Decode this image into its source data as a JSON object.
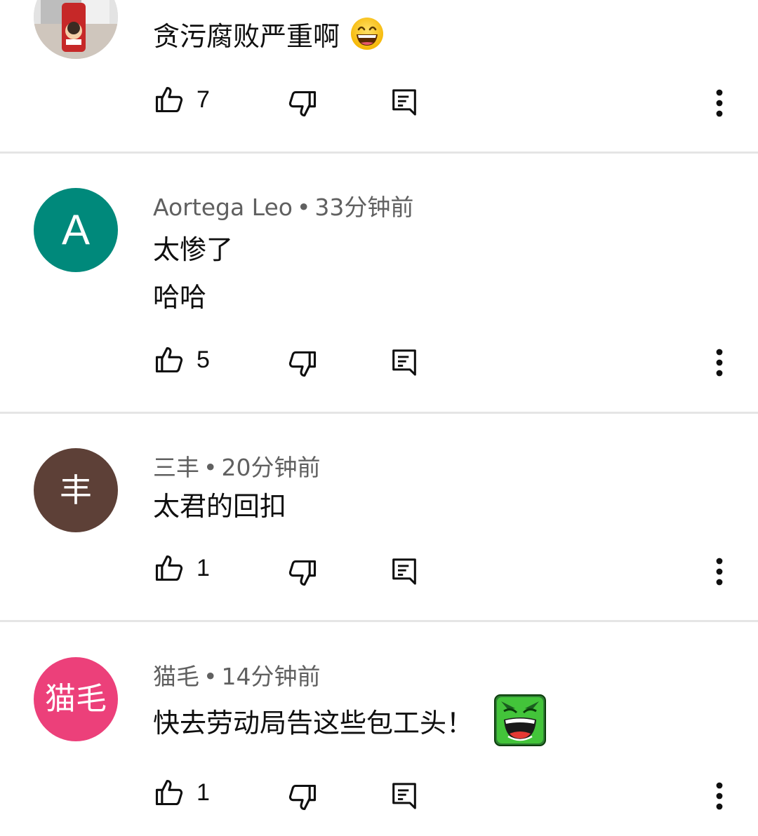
{
  "comments": [
    {
      "author": "",
      "time": "",
      "lines": [
        "贪污腐败严重啊"
      ],
      "emoji": "grinning-face-emoji",
      "likes": "7",
      "avatar_type": "photo",
      "avatar_text": ""
    },
    {
      "author": "Aortega Leo",
      "time": "33分钟前",
      "lines": [
        "太惨了",
        "哈哈"
      ],
      "likes": "5",
      "avatar_type": "letter",
      "avatar_text": "A",
      "avatar_color": "#00897b"
    },
    {
      "author": "三丰",
      "time": "20分钟前",
      "lines": [
        "太君的回扣"
      ],
      "likes": "1",
      "avatar_type": "letter",
      "avatar_text": "丰",
      "avatar_color": "#5d4037"
    },
    {
      "author": "猫毛",
      "time": "14分钟前",
      "lines": [
        "快去劳动局告这些包工头！"
      ],
      "emoji": "hulk-laughing-sticker",
      "likes": "1",
      "avatar_type": "letter",
      "avatar_text": "猫毛",
      "avatar_color": "#ec407a"
    }
  ],
  "meta_separator": "•",
  "icons": {
    "like": "thumbs-up-icon",
    "dislike": "thumbs-down-icon",
    "reply": "reply-icon",
    "more": "more-vertical-icon"
  }
}
